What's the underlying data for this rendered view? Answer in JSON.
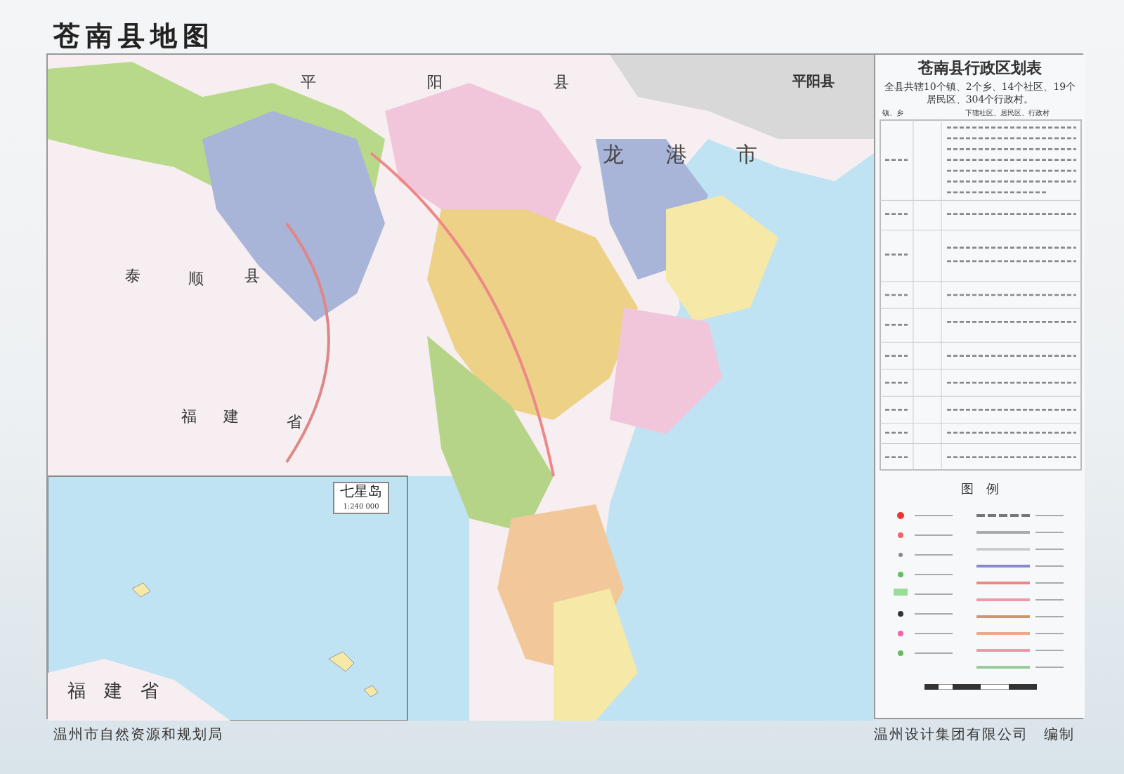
{
  "title": "苍南县地图",
  "map": {
    "labels": [
      "平",
      "阳",
      "县",
      "龙",
      "港",
      "市",
      "平阳县",
      "泰",
      "顺",
      "县",
      "福",
      "建",
      "省"
    ]
  },
  "inset": {
    "name": "七星岛",
    "scale": "1:240 000",
    "labels": [
      "福",
      "建",
      "省"
    ]
  },
  "panel": {
    "title": "苍南县行政区划表",
    "summary": "全县共辖10个镇、2个乡、14个社区、19个居民区、304个行政村。",
    "columns": [
      "镇、乡",
      "下辖社区、居民区、行政村"
    ],
    "legend_title": "图　例"
  },
  "footer": {
    "left": "温州市自然资源和规划局",
    "right": "温州设计集团有限公司　编制"
  }
}
